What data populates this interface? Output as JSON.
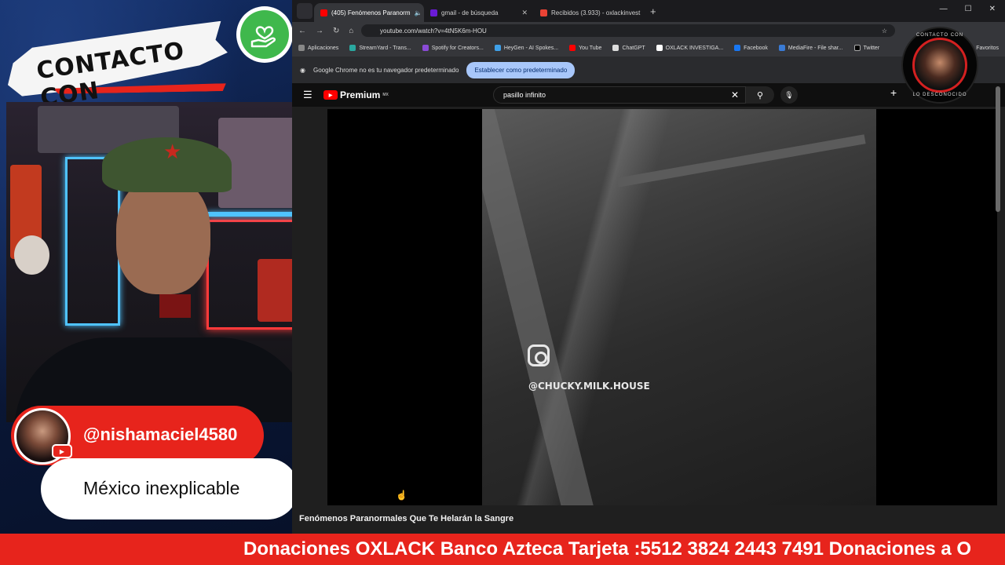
{
  "overlay": {
    "banner_text": "CONTACTO CON",
    "user": {
      "handle": "@nishamaciel4580",
      "comment": "México inexplicable"
    },
    "ticker": "Donaciones OXLACK Banco Azteca Tarjeta :5512 3824 2443 7491 Donaciones a O",
    "channel_logo": {
      "text_top": "CONTACTO CON",
      "text_bottom": "LO DESCONOCIDO"
    },
    "colors": {
      "accent_red": "#e7241c",
      "heart_green": "#3fb84c"
    }
  },
  "browser": {
    "tabs": [
      {
        "label": "(405) Fenómenos Paranorm",
        "active": true,
        "icon": "youtube-icon"
      },
      {
        "label": "gmail - de búsqueda",
        "active": false,
        "icon": "yahoo-icon"
      },
      {
        "label": "Recibidos (3.933) - oxlackinvest",
        "active": false,
        "icon": "gmail-icon"
      }
    ],
    "url": "youtube.com/watch?v=4tN5K6m-HOU",
    "bookmarks": [
      "Aplicaciones",
      "StreamYard - Trans...",
      "Spotify for Creators...",
      "HeyGen - AI Spokes...",
      "You Tube",
      "ChatGPT",
      "OXLACK INVESTIGA...",
      "Facebook",
      "MediaFire - File shar...",
      "Twitter"
    ],
    "bookmarks_right": "Favoritos",
    "infobar": {
      "message": "Google Chrome no es tu navegador predeterminado",
      "button": "Establecer como predeterminado"
    }
  },
  "youtube": {
    "logo": "Premium",
    "logo_sup": "MX",
    "search_query": "pasillo infinito",
    "video_overlay_handle": "@CHUCKY.MILK.HOUSE",
    "video_title": "Fenómenos Paranormales Que Te Helarán la Sangre"
  }
}
